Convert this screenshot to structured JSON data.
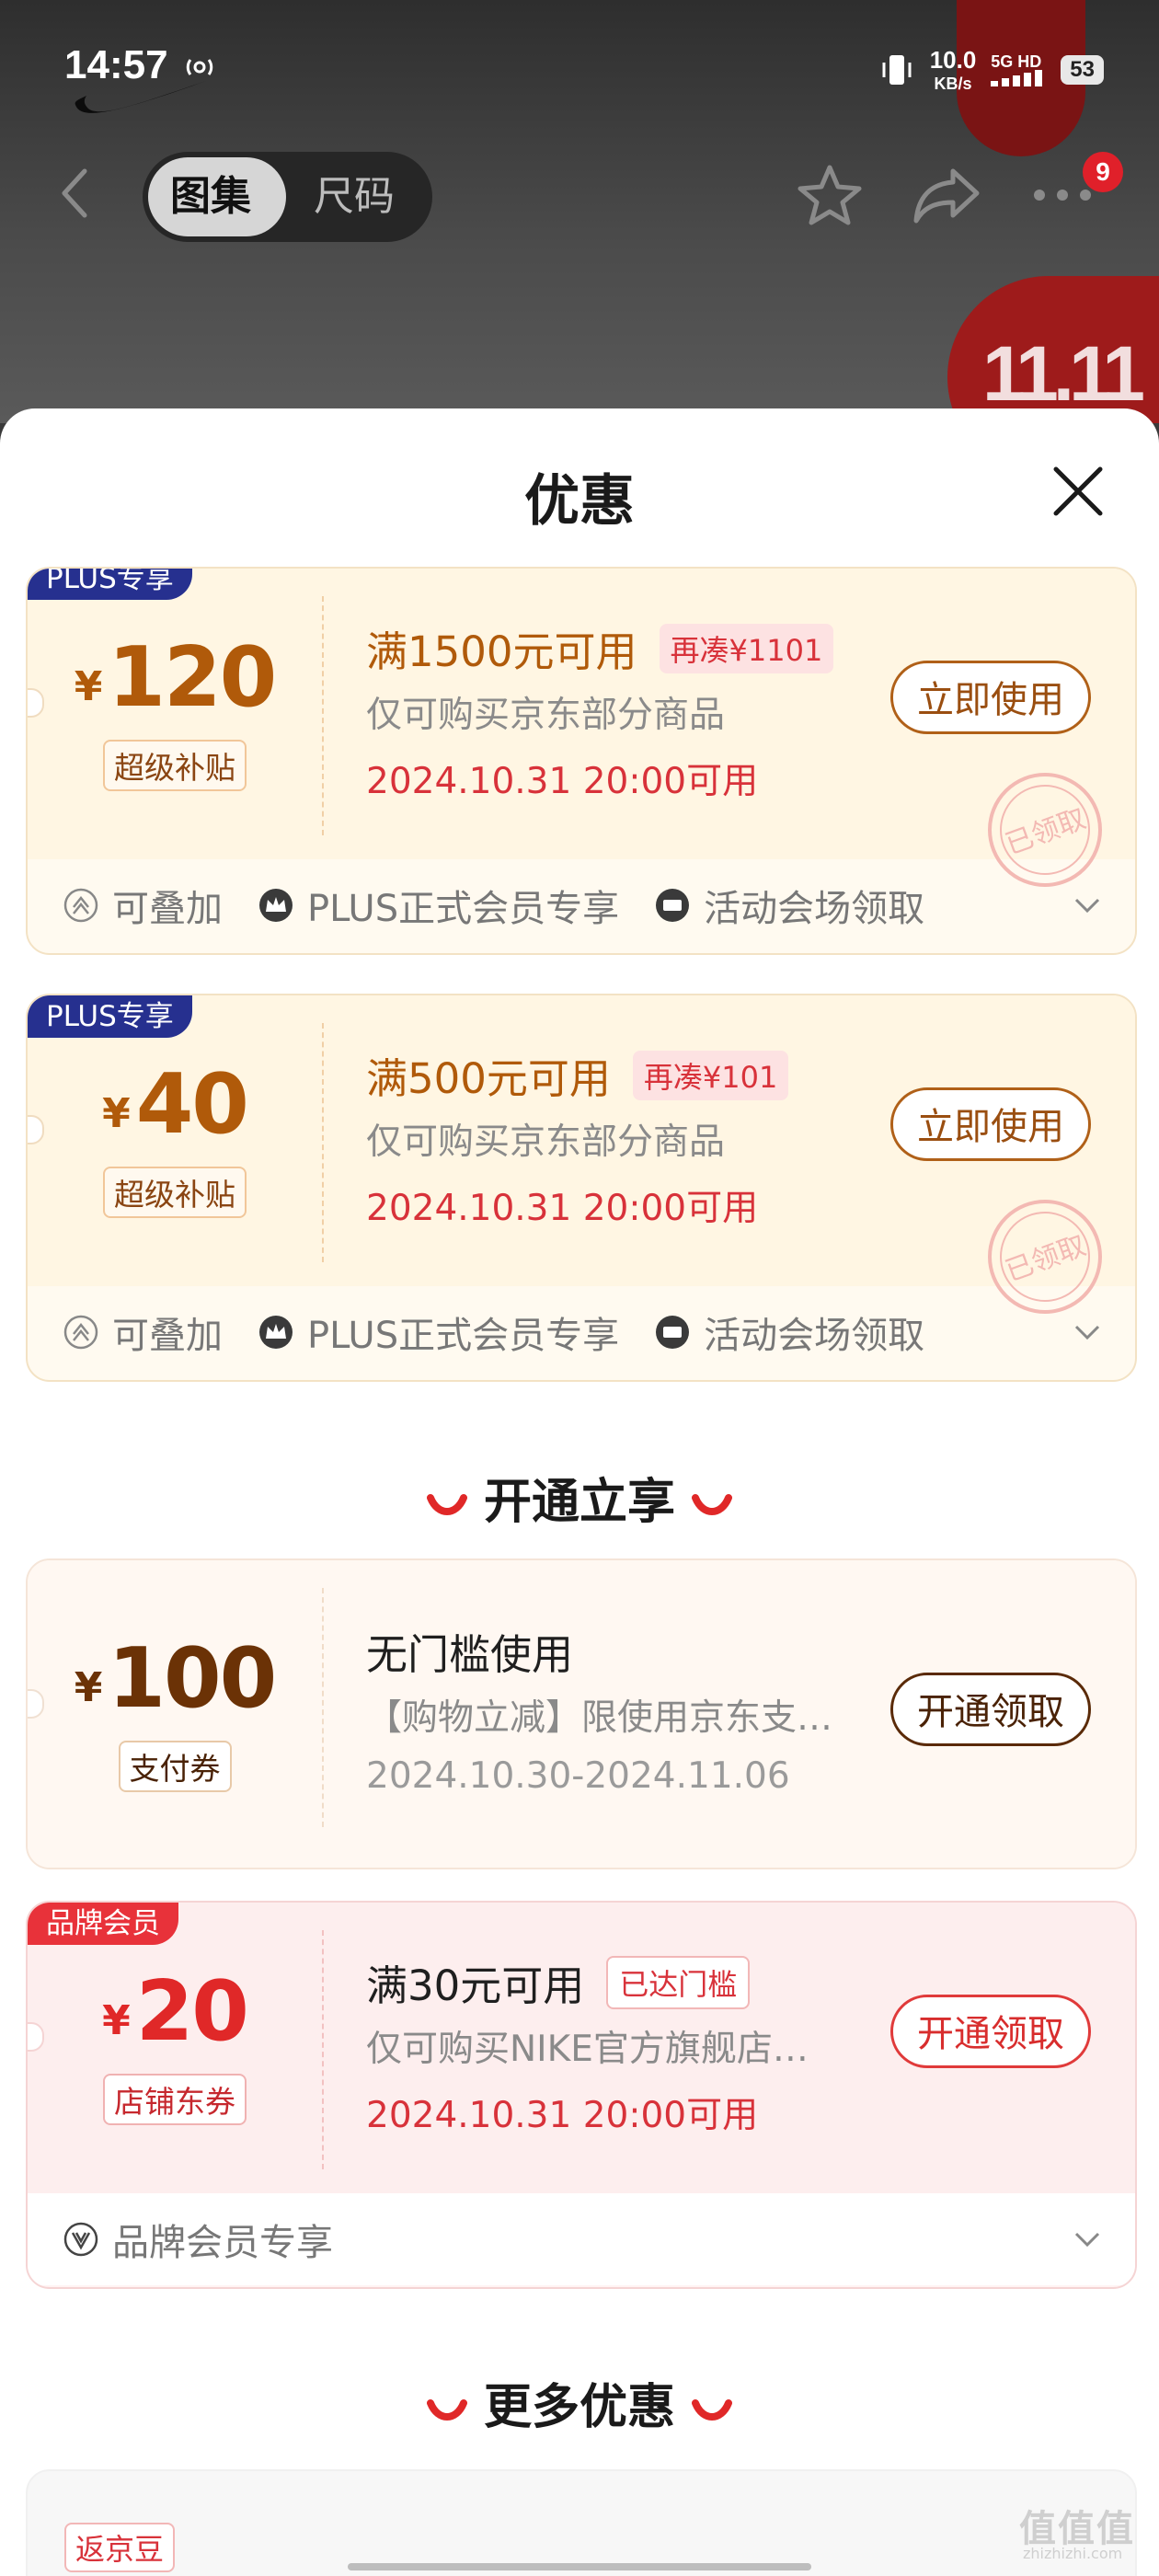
{
  "status_bar": {
    "time": "14:57",
    "net_speed_value": "10.0",
    "net_speed_unit": "KB/s",
    "network_top": "5G HD",
    "battery": "53"
  },
  "header": {
    "tabs": [
      "图集",
      "尺码"
    ],
    "active_tab": "图集",
    "more_badge": "9",
    "icons": [
      "back-arrow-icon",
      "star-icon",
      "share-icon",
      "more-icon"
    ]
  },
  "sheet": {
    "title": "优惠"
  },
  "coupons": [
    {
      "tag": "PLUS专享",
      "currency": "¥",
      "amount": "120",
      "sub_label": "超级补贴",
      "condition": "满1500元可用",
      "condition_pill": "再凑¥1101",
      "description": "仅可购买京东部分商品",
      "date": "2024.10.31 20:00可用",
      "button": "立即使用",
      "stamp": "已领取",
      "features": [
        "可叠加",
        "PLUS正式会员专享",
        "活动会场领取"
      ]
    },
    {
      "tag": "PLUS专享",
      "currency": "¥",
      "amount": "40",
      "sub_label": "超级补贴",
      "condition": "满500元可用",
      "condition_pill": "再凑¥101",
      "description": "仅可购买京东部分商品",
      "date": "2024.10.31 20:00可用",
      "button": "立即使用",
      "stamp": "已领取",
      "features": [
        "可叠加",
        "PLUS正式会员专享",
        "活动会场领取"
      ]
    }
  ],
  "section_open": {
    "title": "开通立享"
  },
  "open_coupons": [
    {
      "currency": "¥",
      "amount": "100",
      "sub_label": "支付券",
      "condition": "无门槛使用",
      "description": "【购物立减】限使用京东支…",
      "date": "2024.10.30-2024.11.06",
      "button": "开通领取"
    },
    {
      "tag": "品牌会员",
      "currency": "¥",
      "amount": "20",
      "sub_label": "店铺东券",
      "condition": "满30元可用",
      "condition_pill": "已达门槛",
      "description": "仅可购买NIKE官方旗舰店…",
      "date": "2024.10.31 20:00可用",
      "button": "开通领取",
      "features": [
        "品牌会员专享"
      ]
    }
  ],
  "section_more": {
    "title": "更多优惠",
    "first_tag": "返京豆"
  },
  "watermark": {
    "main": "值值值",
    "sub": "zhizhizhi.com"
  },
  "colors": {
    "accent_red": "#e02828",
    "plus_brown": "#b05a0a",
    "plus_navy": "#26308f"
  }
}
